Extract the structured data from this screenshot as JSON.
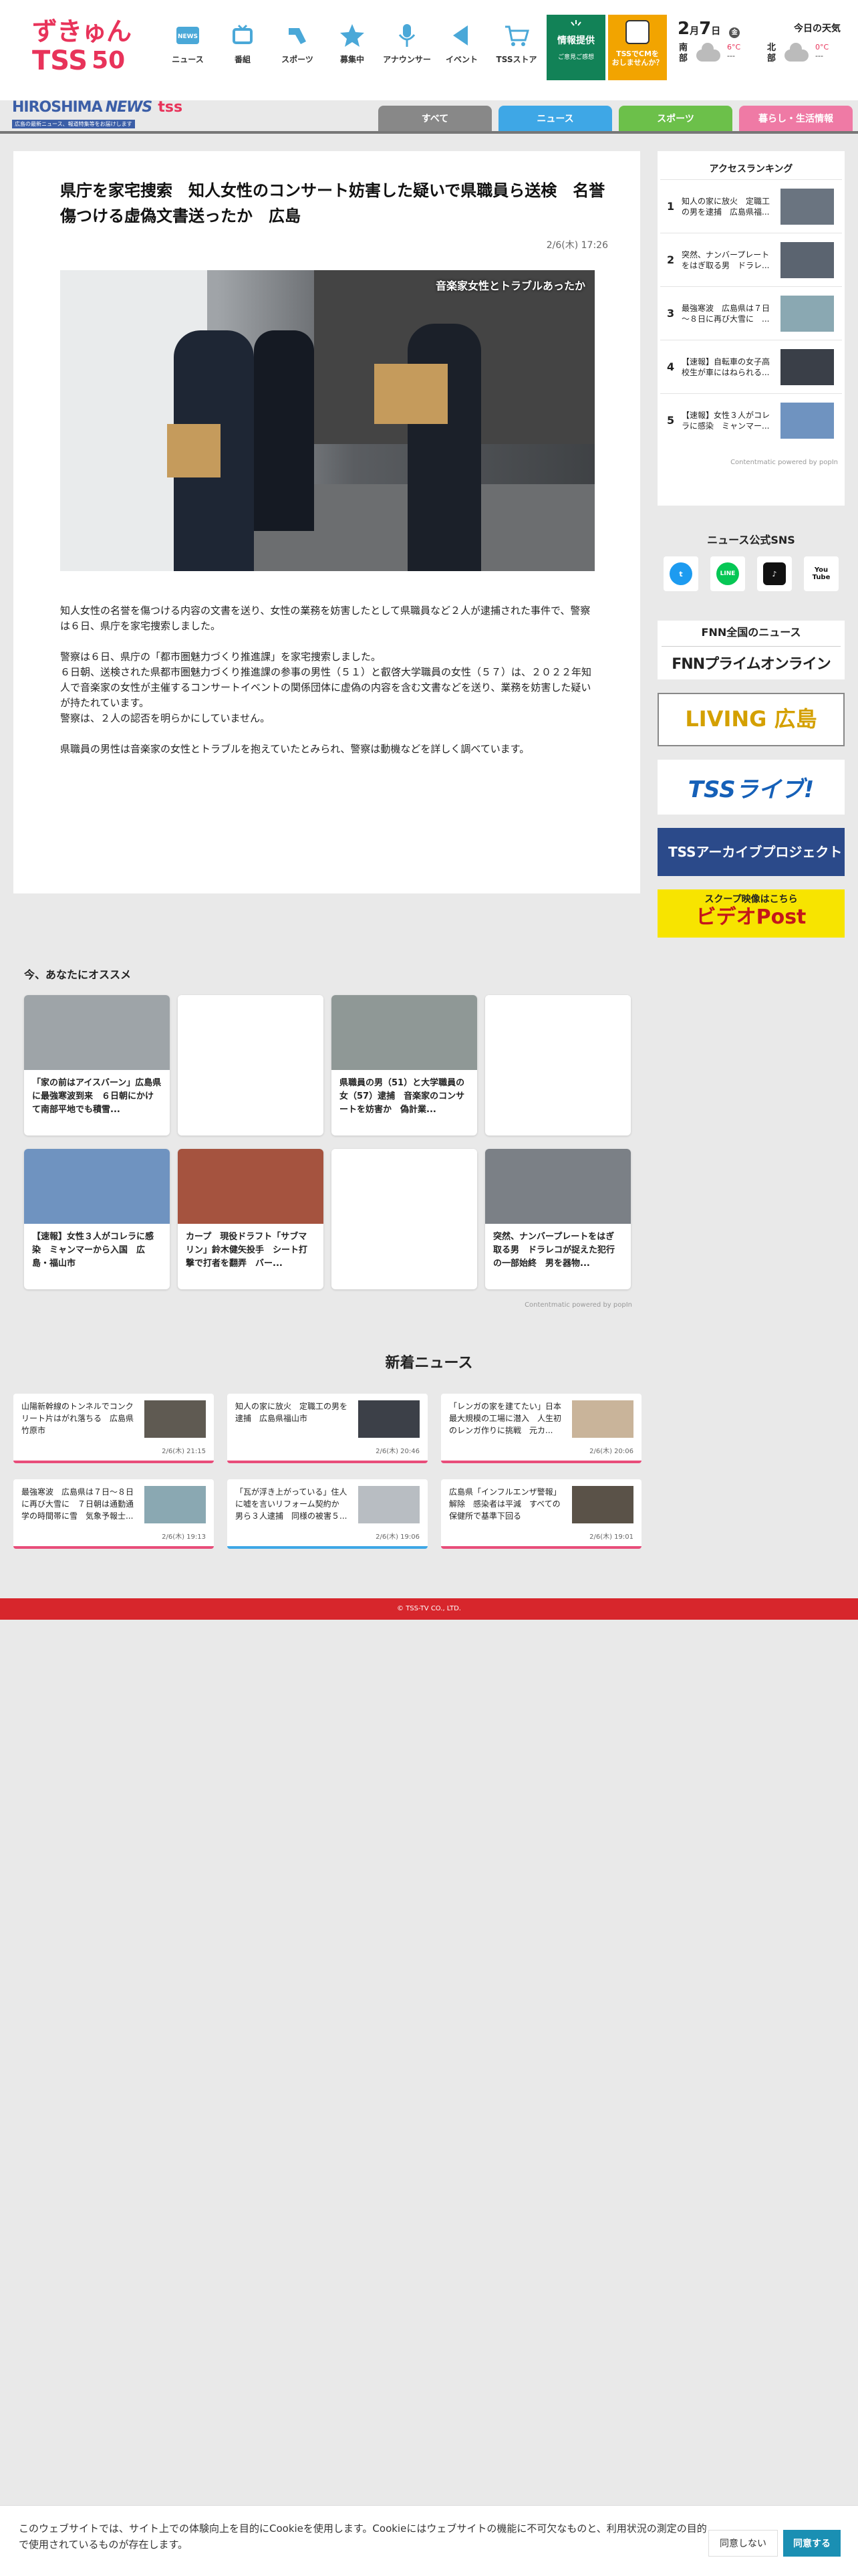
{
  "header": {
    "logo_top": "ずきゅん",
    "logo_bottom": "TSS",
    "logo_anniv": "50",
    "nav": [
      {
        "label": "ニュース",
        "icon": "news-icon"
      },
      {
        "label": "番組",
        "icon": "tv-icon"
      },
      {
        "label": "スポーツ",
        "icon": "sports-icon"
      },
      {
        "label": "募集中",
        "icon": "star-icon"
      },
      {
        "label": "アナウンサー",
        "icon": "announcer-icon"
      },
      {
        "label": "イベント",
        "icon": "flag-icon"
      },
      {
        "label": "TSSストア",
        "icon": "cart-icon"
      }
    ],
    "info_box": {
      "title": "情報提供",
      "sub": "ご意見ご感想"
    },
    "tss_cm": {
      "text": "TSSでCMを\nおしませんか？"
    },
    "weather": {
      "title": "今日の天気",
      "date_month": "2",
      "date_day": "7",
      "date_label_month": "月",
      "date_label_day": "日",
      "weekday": "金",
      "areas": [
        {
          "name": "南部",
          "high": "6°C",
          "low": "---"
        },
        {
          "name": "北部",
          "high": "0°C",
          "low": "---"
        }
      ]
    }
  },
  "subheader": {
    "logo": "HIROSHIMA",
    "logo_news": "NEWS",
    "logo_tss": "tss",
    "tagline": "広島の最新ニュース、報道特集等をお届けします"
  },
  "tabs": [
    {
      "label": "すべて",
      "color": "#888888"
    },
    {
      "label": "ニュース",
      "color": "#3ea7e6"
    },
    {
      "label": "スポーツ",
      "color": "#6cc04a"
    },
    {
      "label": "暮らし・生活情報",
      "color": "#ef7aa5"
    }
  ],
  "article": {
    "title": "県庁を家宅捜索　知人女性のコンサート妨害した疑いで県職員ら送検　名誉傷つける虚偽文書送ったか　広島",
    "date": "2/6(木) 17:26",
    "image_caption": "音楽家女性とトラブルあったか",
    "paragraphs": [
      "知人女性の名誉を傷つける内容の文書を送り、女性の業務を妨害したとして県職員など２人が逮捕された事件で、警察は６日、県庁を家宅捜索しました。",
      "警察は６日、県庁の「都市圏魅力づくり推進課」を家宅捜索しました。\n６日朝、送検された県都市圏魅力づくり推進課の参事の男性（５１）と叡啓大学職員の女性（５７）は、２０２２年知人で音楽家の女性が主催するコンサートイベントの関係団体に虚偽の内容を含む文書などを送り、業務を妨害した疑いが持たれています。\n警察は、２人の認否を明らかにしていません。",
      "県職員の男性は音楽家の女性とトラブルを抱えていたとみられ、警察は動機などを詳しく調べています。"
    ]
  },
  "ranking": {
    "title": "アクセスランキング",
    "items": [
      {
        "rank": "1",
        "text": "知人の家に放火　定職工の男を逮捕　広島県福..."
      },
      {
        "rank": "2",
        "text": "突然、ナンバープレートをはぎ取る男　ドラレ..."
      },
      {
        "rank": "3",
        "text": "最強寒波　広島県は７日～８日に再び大雪に　..."
      },
      {
        "rank": "4",
        "text": "【速報】自転車の女子高校生が車にはねられる..."
      },
      {
        "rank": "5",
        "text": "【速報】女性３人がコレラに感染　ミャンマー..."
      }
    ],
    "powered": "Contentmatic powered by popIn"
  },
  "sns": {
    "title": "ニュース公式SNS",
    "buttons": [
      {
        "name": "twitter",
        "label": "t",
        "color": "#1d9bf0"
      },
      {
        "name": "line",
        "label": "LINE",
        "color": "#06c755"
      },
      {
        "name": "tiktok",
        "label": "♪",
        "color": "#111111"
      },
      {
        "name": "youtube",
        "label": "You Tube",
        "color": "#ffffff"
      }
    ]
  },
  "banners": {
    "fnn_title": "FNN全国のニュース",
    "fnn_logo": "FNNプライムオンライン",
    "living": "LIVING",
    "living_area": "広島",
    "live": "TSSライブ!",
    "archive": "TSSアーカイブプロジェクト",
    "videopost_sub": "スクープ映像はこちら",
    "videopost": "ビデオPost"
  },
  "recommend": {
    "title": "今、あなたにオススメ",
    "cards": [
      {
        "text": "「家の前はアイスバーン」広島県に最強寒波到来　６日朝にかけて南部平地でも積雪...",
        "thumb": "#9ea4a8"
      },
      {
        "text": "",
        "thumb": "#ffffff"
      },
      {
        "text": "県職員の男（51）と大学職員の女（57）逮捕　音楽家のコンサートを妨害か　偽計業...",
        "thumb": "#8f9896"
      },
      {
        "text": "",
        "thumb": "#ffffff"
      },
      {
        "text": "【速報】女性３人がコレラに感染　ミャンマーから入国　広島・福山市",
        "thumb": "#6f93c0"
      },
      {
        "text": "カープ　現役ドラフト「サブマリン」鈴木健矢投手　シート打撃で打者を翻弄　バー...",
        "thumb": "#a5533f"
      },
      {
        "text": "",
        "thumb": "#ffffff"
      },
      {
        "text": "突然、ナンバープレートをはぎ取る男　ドラレコが捉えた犯行の一部始終　男を器物...",
        "thumb": "#7b8086"
      }
    ],
    "powered": "Contentmatic powered by popIn"
  },
  "new_news": {
    "title": "新着ニュース",
    "items": [
      {
        "text": "山陽新幹線のトンネルでコンクリート片はがれ落ちる　広島県竹原市",
        "date": "2/6(木) 21:15",
        "border": "#e84d7a"
      },
      {
        "text": "知人の家に放火　定職工の男を逮捕　広島県福山市",
        "date": "2/6(木) 20:46",
        "border": "#e84d7a"
      },
      {
        "text": "「レンガの家を建てたい」日本最大規模の工場に潜入　人生初のレンガ作りに挑戦　元カ...",
        "date": "2/6(木) 20:06",
        "border": "#e84d7a"
      },
      {
        "text": "最強寒波　広島県は７日～８日に再び大雪に　７日朝は通勤通学の時間帯に雪　気象予報士...",
        "date": "2/6(木) 19:13",
        "border": "#e84d7a"
      },
      {
        "text": "「瓦が浮き上がっている」住人に嘘を言いリフォーム契約か　男ら３人逮捕　同様の被害５...",
        "date": "2/6(木) 19:06",
        "border": "#3ea7e6"
      },
      {
        "text": "広島県「インフルエンザ警報」解除　感染者は平減　すべての保健所で基準下回る",
        "date": "2/6(木) 19:01",
        "border": "#e84d7a"
      }
    ]
  },
  "footer": {
    "copyright": "© TSS-TV CO., LTD."
  },
  "cookie": {
    "message": "このウェブサイトでは、サイト上での体験向上を目的にCookieを使用します。Cookieにはウェブサイトの機能に不可欠なものと、利用状況の測定の目的で使用されているものが存在します。",
    "decline": "同意しない",
    "accept": "同意する"
  }
}
